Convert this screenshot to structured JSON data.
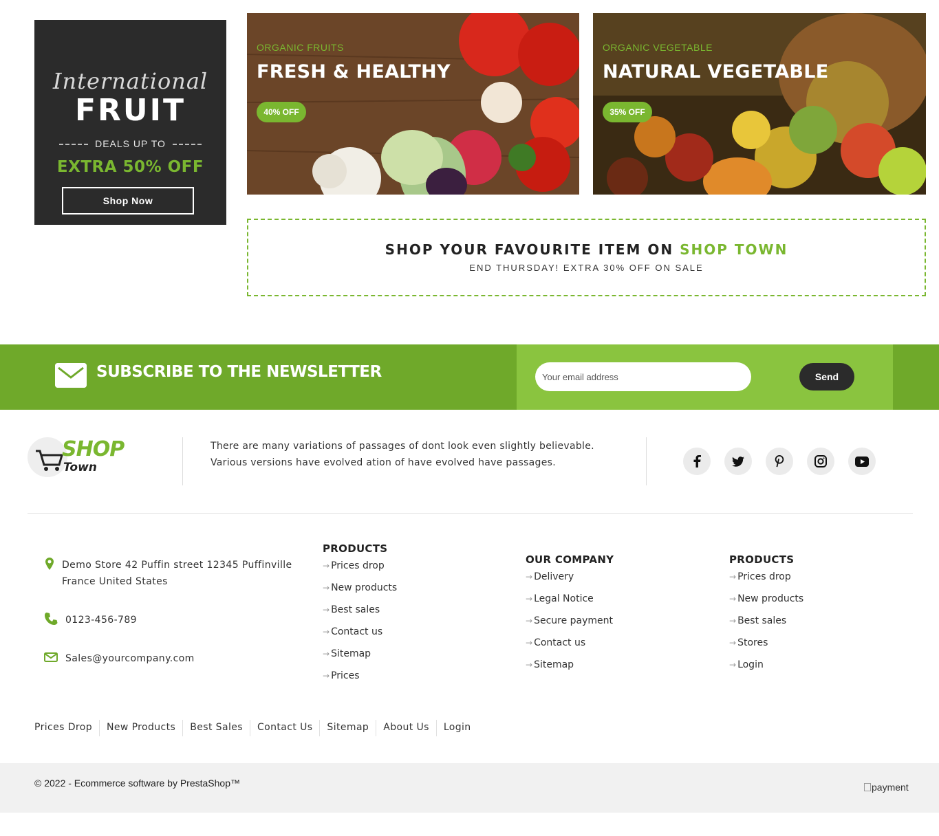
{
  "promo": {
    "script_title": "International",
    "main_title": "FRUIT",
    "deals_text": "DEALS UP TO",
    "offer_text": "EXTRA 50% OFF",
    "button_label": "Shop Now"
  },
  "banners": [
    {
      "subtitle": "ORGANIC FRUITS",
      "title": "FRESH & HEALTHY",
      "badge": "40% OFF"
    },
    {
      "subtitle": "ORGANIC VEGETABLE",
      "title": "NATURAL VEGETABLE",
      "badge": "35% OFF"
    }
  ],
  "shop_banner": {
    "heading_prefix": "SHOP YOUR FAVOURITE ITEM ON",
    "heading_brand": "SHOP TOWN",
    "subheading": "END THURSDAY! EXTRA 30% OFF ON SALE"
  },
  "newsletter": {
    "title": "SUBSCRIBE TO THE NEWSLETTER",
    "placeholder": "Your email address",
    "send_label": "Send"
  },
  "footer": {
    "logo_shop": "SHOP",
    "logo_town": "Town",
    "about": "There are many variations of passages of dont look even slightly believable. Various versions have evolved ation of have evolved have passages.",
    "social": [
      "facebook-icon",
      "twitter-icon",
      "pinterest-icon",
      "instagram-icon",
      "youtube-icon"
    ],
    "contact": {
      "address": [
        "Demo Store 42 Puffin street 12345 Puffinville",
        "France United States"
      ],
      "phone": "0123-456-789",
      "email": "Sales@yourcompany.com"
    },
    "columns": [
      {
        "title": "PRODUCTS",
        "links": [
          "Prices drop",
          "New products",
          "Best sales",
          "Contact us",
          "Sitemap",
          "Prices"
        ]
      },
      {
        "title": "OUR COMPANY",
        "links": [
          "Delivery",
          "Legal Notice",
          "Secure payment",
          "Contact us",
          "Sitemap"
        ]
      },
      {
        "title": "PRODUCTS",
        "links": [
          "Prices drop",
          "New products",
          "Best sales",
          "Stores",
          "Login"
        ]
      }
    ],
    "bottom_links": [
      "Prices Drop",
      "New Products",
      "Best Sales",
      "Contact Us",
      "Sitemap",
      "About Us",
      "Login"
    ],
    "copyright": "© 2022 - Ecommerce software by PrestaShop™",
    "payment_alt": "payment"
  },
  "colors": {
    "accent": "#7ab730",
    "dark": "#2b2b2b"
  }
}
